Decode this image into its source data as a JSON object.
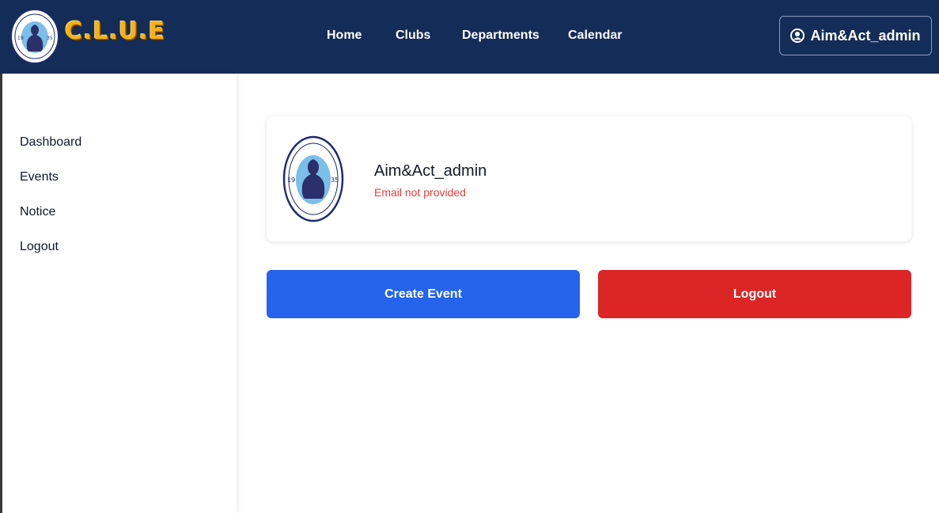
{
  "navbar": {
    "brand": "C.L.U.E",
    "links": [
      "Home",
      "Clubs",
      "Departments",
      "Calendar"
    ],
    "user_label": "Aim&Act_admin",
    "user_icon": "user-circle-icon",
    "background": "#142c58",
    "brand_color": "#f2b21c"
  },
  "seal": {
    "top_text": "वनस्थली विद्यापीठ",
    "bottom_text": "सा विद्या या विमुक्तये",
    "year_left": "19",
    "year_right": "35"
  },
  "sidebar": {
    "items": [
      "Dashboard",
      "Events",
      "Notice",
      "Logout"
    ]
  },
  "profile": {
    "name": "Aim&Act_admin",
    "email": "Email not provided",
    "email_color": "#e53e3e"
  },
  "actions": {
    "create_label": "Create Event",
    "logout_label": "Logout",
    "create_color": "#2563eb",
    "logout_color": "#dc2626"
  }
}
